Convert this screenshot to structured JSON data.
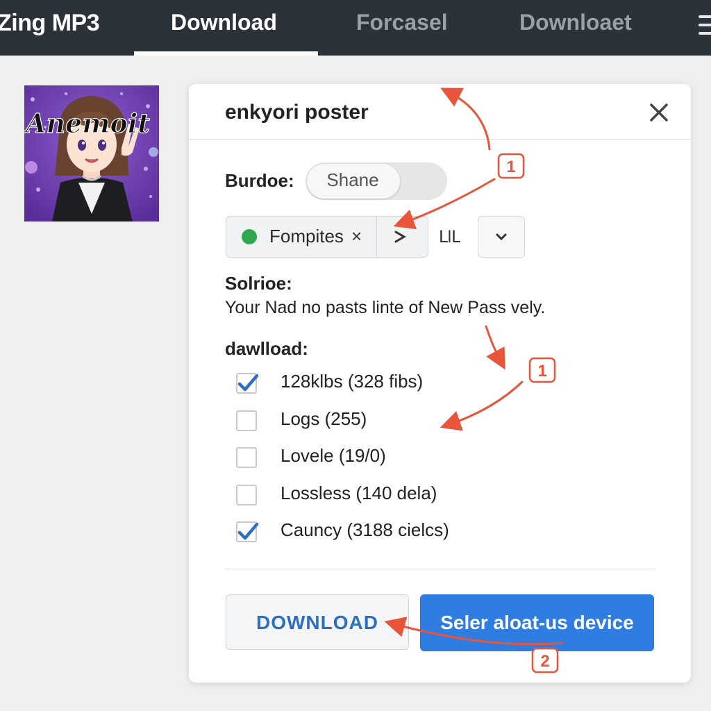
{
  "nav": {
    "brand": "Zing MP3",
    "tabs": [
      {
        "label": "Download",
        "active": true
      },
      {
        "label": "Forcasel",
        "active": false
      },
      {
        "label": "Downloaet",
        "active": false
      }
    ]
  },
  "album": {
    "art_text": "Anemoit"
  },
  "dialog": {
    "title": "enkyori poster",
    "bundle_label": "Burdoe:",
    "toggle_value": "Shane",
    "chip": {
      "label": "Fompites",
      "remove_glyph": "×",
      "arrow_glyph": "›"
    },
    "lil_label": "ԼlԼ",
    "source_label": "Solrioe:",
    "source_description": "Your Nad no pasts linte of New Pass vely.",
    "download_label": "dawlload:",
    "options": [
      {
        "label": "128klbs (328 fibs)",
        "checked": true
      },
      {
        "label": "Logs (255)",
        "checked": false
      },
      {
        "label": "Lovele (19/0)",
        "checked": false
      },
      {
        "label": "Lossless (140 dela)",
        "checked": false
      },
      {
        "label": "Cauncy (3188 cielcs)",
        "checked": true
      }
    ],
    "download_button": "DOWNLOAD",
    "device_button": "Seler aloat-us device"
  },
  "annotations": {
    "markers": [
      "1",
      "1",
      "2"
    ],
    "color": "#e8553a"
  },
  "colors": {
    "nav_bg": "#2c323a",
    "accent_blue": "#2f7de1",
    "check_blue": "#2b6fc4",
    "chip_dot": "#2fa84f"
  }
}
